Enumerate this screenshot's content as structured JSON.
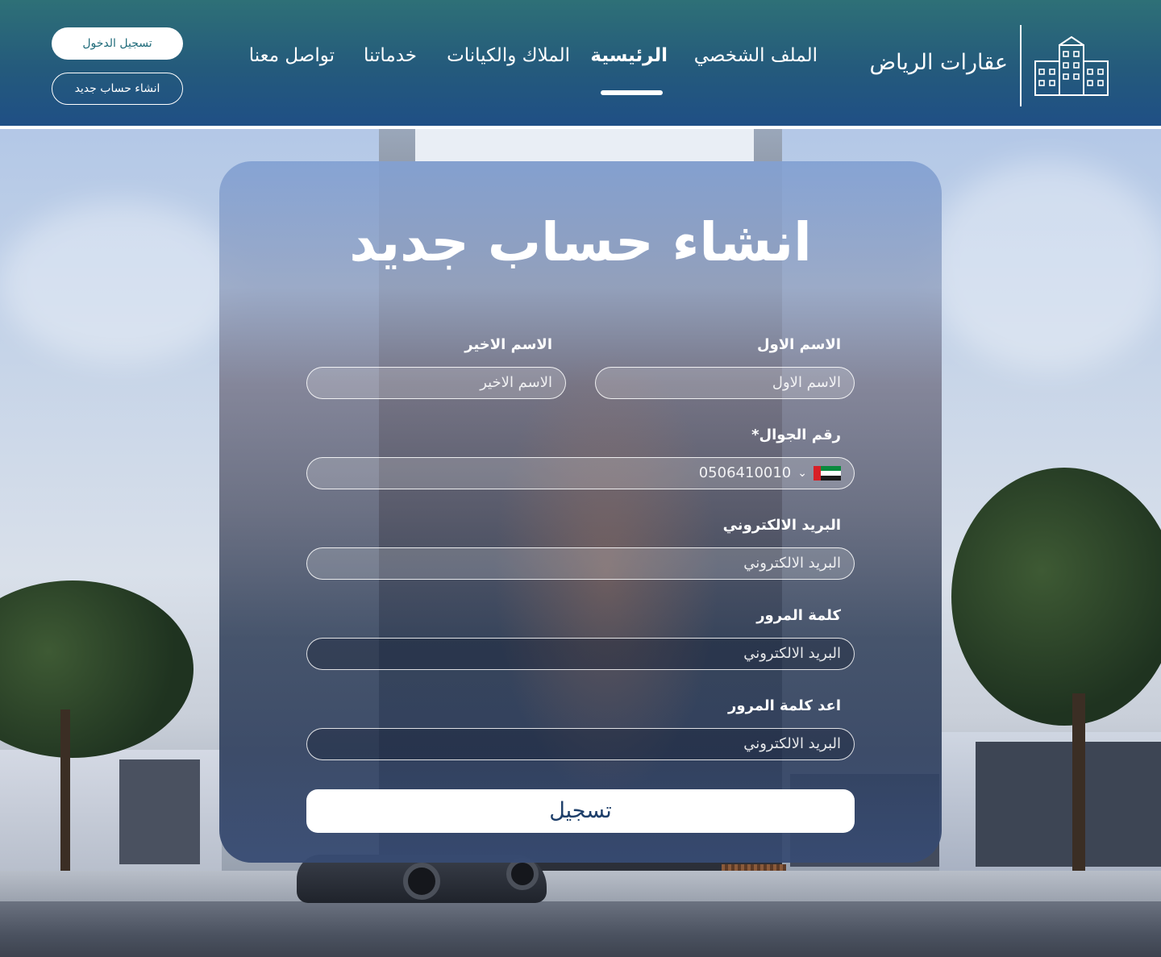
{
  "header": {
    "brand": "عقارات الرياض",
    "nav": {
      "profile": "الملف الشخصي",
      "home": "الرئيسية",
      "properties": "الملاك والكيانات",
      "services": "خدماتنا",
      "contact": "تواصل معنا"
    },
    "active_nav": "home",
    "login_label": "تسجيل الدخول",
    "register_label": "انشاء حساب جديد"
  },
  "form": {
    "title": "انشاء حساب جديد",
    "first_name": {
      "label": "الاسم الاول",
      "placeholder": "الاسم الاول"
    },
    "last_name": {
      "label": "الاسم الاخير",
      "placeholder": "الاسم الاخير"
    },
    "phone": {
      "label": "رقم الجوال*",
      "value": "0506410010",
      "country": "AE"
    },
    "email": {
      "label": "البريد الالكتروني",
      "placeholder": "البريد الالكتروني"
    },
    "password": {
      "label": "كلمة المرور",
      "placeholder": "البريد الالكتروني"
    },
    "confirm_password": {
      "label": "اعد كلمة المرور",
      "placeholder": "البريد الالكتروني"
    },
    "submit_label": "تسجيل"
  },
  "colors": {
    "header_gradient_top": "#2e7077",
    "header_gradient_bottom": "#1f4f85",
    "login_text": "#1f6b7a",
    "submit_text": "#1e3f6a"
  },
  "icons": {
    "logo": "buildings-icon",
    "phone_country": "uae-flag-icon",
    "dropdown": "chevron-down-icon"
  }
}
